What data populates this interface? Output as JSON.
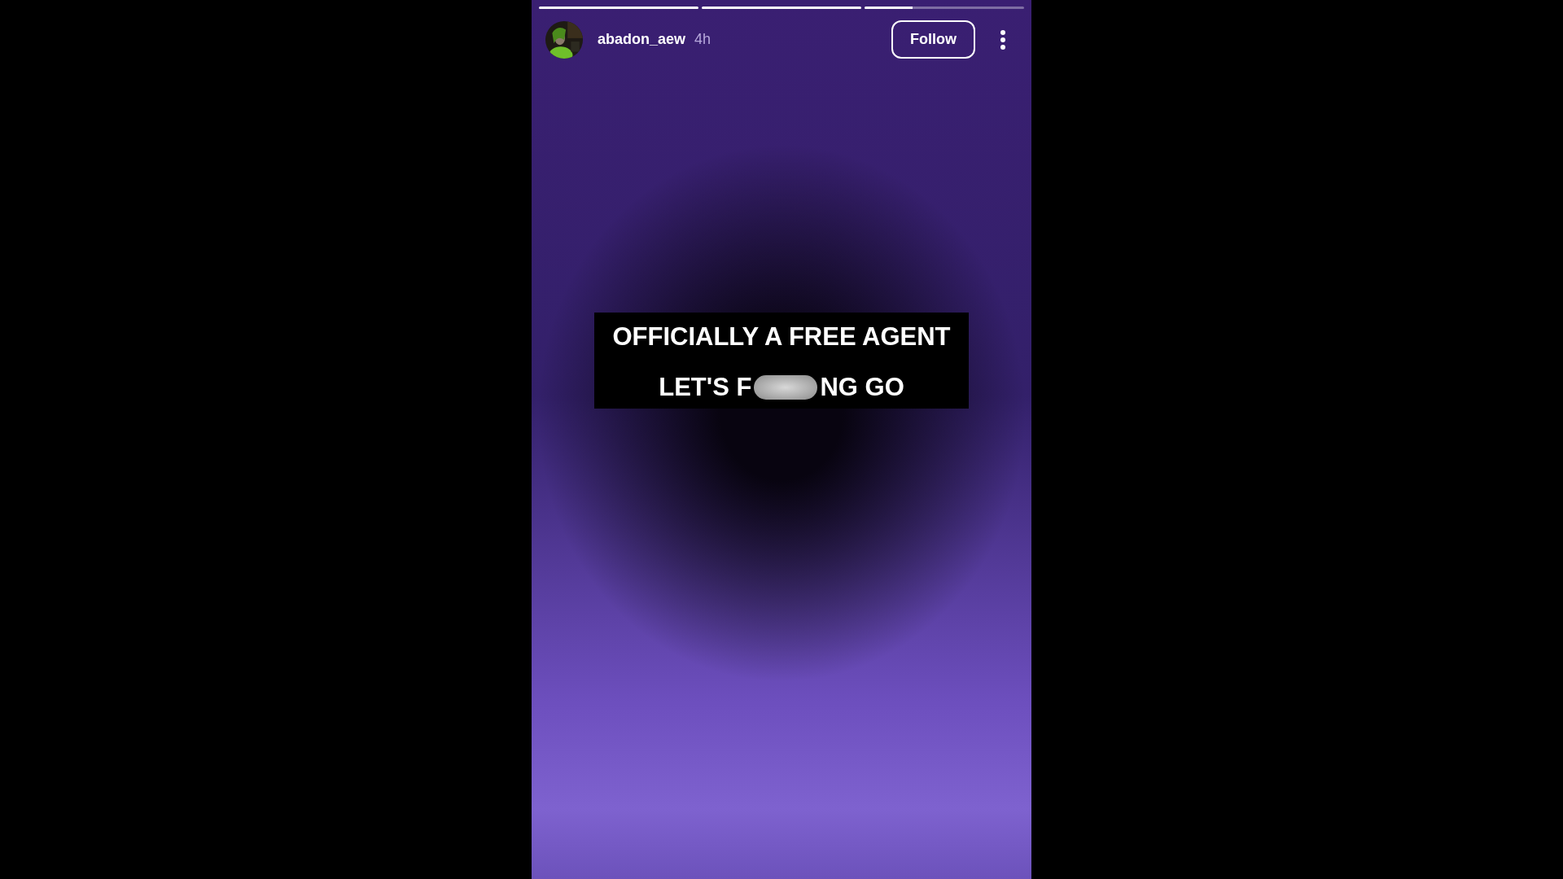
{
  "progress_segments": [
    {
      "level": 1
    },
    {
      "level": 1
    },
    {
      "level": 0.3
    }
  ],
  "author": {
    "username": "abadon_aew",
    "time": "4h"
  },
  "follow_button": "Follow",
  "caption": {
    "lines": [
      {
        "parts": [
          {
            "kind": "text",
            "text": "OFFICIALLY A FREE AGENT"
          }
        ]
      },
      {
        "parts": [
          {
            "kind": "text",
            "text": "LET'S F"
          },
          {
            "kind": "censor"
          },
          {
            "kind": "text",
            "text": "NG GO"
          }
        ]
      }
    ]
  }
}
